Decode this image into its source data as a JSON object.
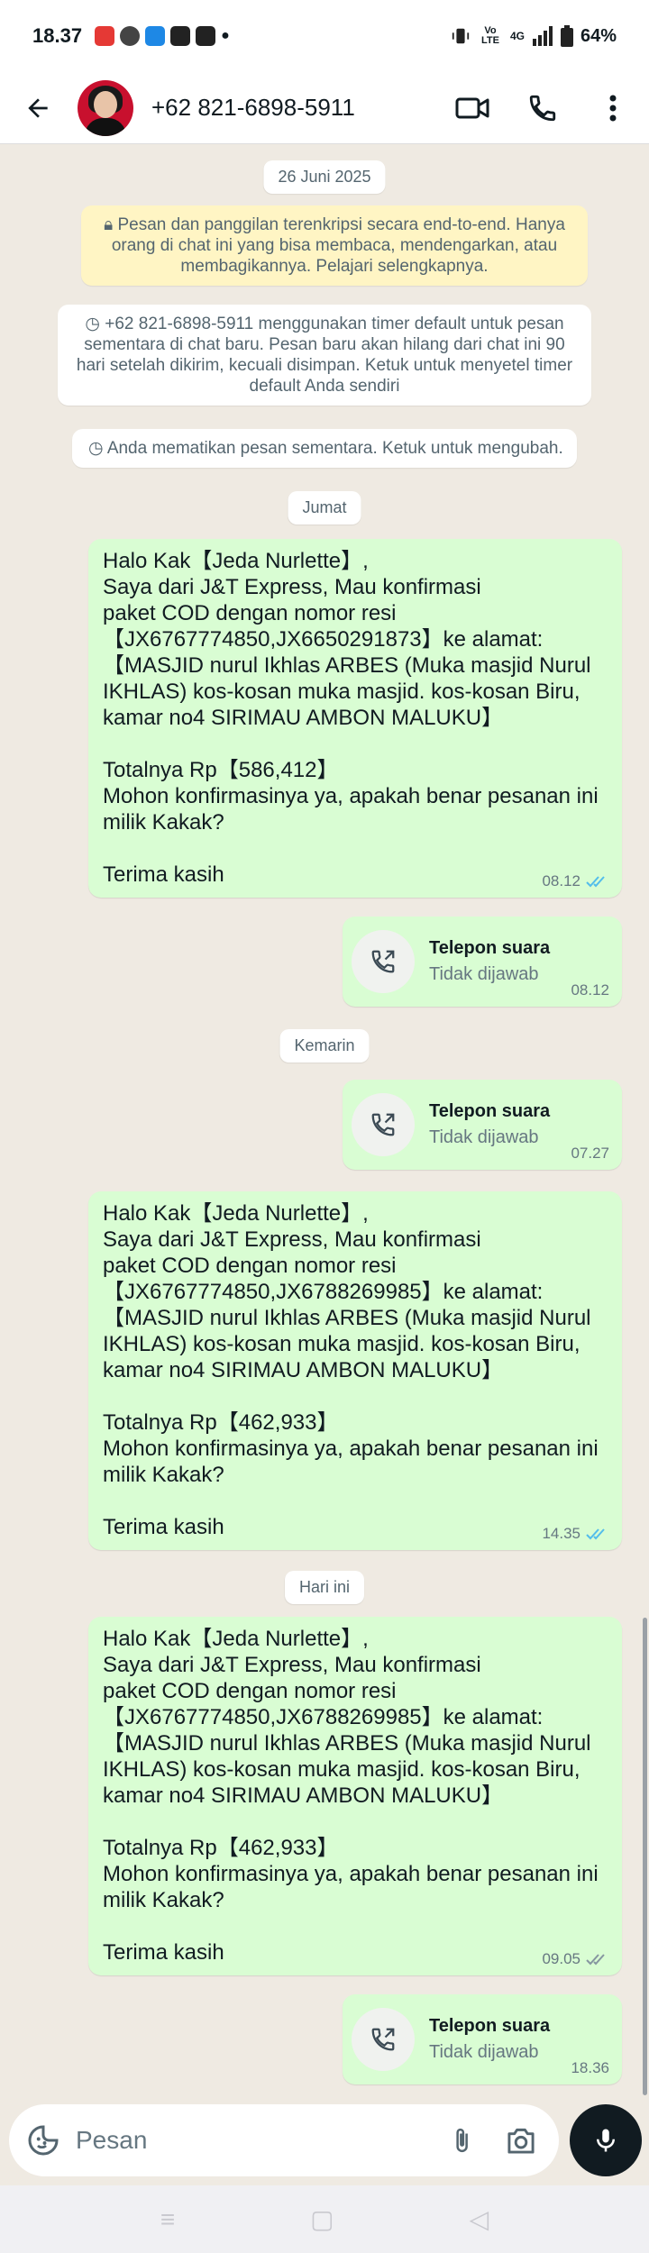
{
  "status": {
    "time": "18.37",
    "battery": "64%",
    "network": "4G",
    "volte": "Vo LTE",
    "icon_colors": [
      "#e53935",
      "#444444",
      "#1e88e5",
      "#222222",
      "#222222"
    ]
  },
  "header": {
    "contact": "+62 821-6898-5911",
    "icons": [
      "back-arrow-icon",
      "video-call-icon",
      "phone-icon",
      "more-vert-icon"
    ]
  },
  "chat": {
    "date_1": "26 Juni 2025",
    "encryption_notice": "Pesan dan panggilan terenkripsi secara end-to-end. Hanya orang di chat ini yang bisa membaca, mendengarkan, atau membagikannya. Pelajari selengkapnya.",
    "timer_notice": "+62 821-6898-5911 menggunakan timer default untuk pesan sementara di chat baru. Pesan baru akan hilang dari chat ini 90 hari setelah dikirim, kecuali disimpan. Ketuk untuk menyetel timer default Anda sendiri",
    "disappearing_off": "Anda mematikan pesan sementara. Ketuk untuk mengubah.",
    "date_2": "Jumat",
    "msg_1": {
      "text": "Halo Kak【Jeda Nurlette】,\nSaya dari J&T Express, Mau konfirmasi\npaket COD dengan nomor resi\n【JX6767774850,JX6650291873】ke alamat:\n【MASJID nurul Ikhlas ARBES (Muka masjid Nurul\nIKHLAS) kos-kosan muka masjid. kos-kosan Biru,\nkamar no4 SIRIMAU AMBON MALUKU】\n\nTotalnya Rp【586,412】\nMohon konfirmasinya ya, apakah benar pesanan ini\nmilik Kakak?\n\nTerima kasih",
      "time": "08.12",
      "status": "read"
    },
    "call_1": {
      "title": "Telepon suara",
      "sub": "Tidak dijawab",
      "time": "08.12"
    },
    "date_3": "Kemarin",
    "call_2": {
      "title": "Telepon suara",
      "sub": "Tidak dijawab",
      "time": "07.27"
    },
    "msg_2": {
      "text": "Halo Kak【Jeda Nurlette】,\nSaya dari J&T Express, Mau konfirmasi\npaket COD dengan nomor resi\n【JX6767774850,JX6788269985】ke alamat:\n【MASJID nurul Ikhlas ARBES (Muka masjid Nurul\nIKHLAS) kos-kosan muka masjid. kos-kosan Biru,\nkamar no4 SIRIMAU AMBON MALUKU】\n\nTotalnya Rp【462,933】\nMohon konfirmasinya ya, apakah benar pesanan ini\nmilik Kakak?\n\nTerima kasih",
      "time": "14.35",
      "status": "read"
    },
    "date_4": "Hari ini",
    "msg_3": {
      "text": "Halo Kak【Jeda Nurlette】,\nSaya dari J&T Express, Mau konfirmasi\npaket COD dengan nomor resi\n【JX6767774850,JX6788269985】ke alamat:\n【MASJID nurul Ikhlas ARBES (Muka masjid Nurul\nIKHLAS) kos-kosan muka masjid. kos-kosan Biru,\nkamar no4 SIRIMAU AMBON MALUKU】\n\nTotalnya Rp【462,933】\nMohon konfirmasinya ya, apakah benar pesanan ini\nmilik Kakak?\n\nTerima kasih",
      "time": "09.05",
      "status": "delivered"
    },
    "call_3": {
      "title": "Telepon suara",
      "sub": "Tidak dijawab",
      "time": "18.36"
    }
  },
  "composer": {
    "placeholder": "Pesan",
    "icons": [
      "sticker-icon",
      "attach-icon",
      "camera-icon",
      "mic-icon"
    ]
  },
  "colors": {
    "outgoing_bubble": "#d9fdd3",
    "chat_background": "#efeae2",
    "read_ticks": "#53bdeb",
    "delivered_ticks": "#8696a0",
    "encryption_notice_bg": "#fff5c4"
  }
}
